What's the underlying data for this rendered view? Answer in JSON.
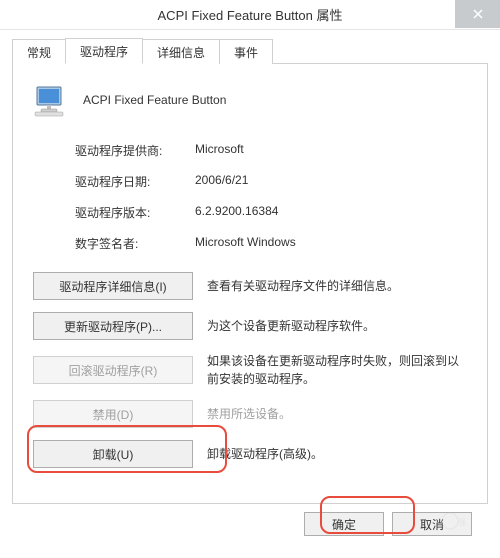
{
  "title": "ACPI Fixed Feature Button 属性",
  "tabs": {
    "general": "常规",
    "driver": "驱动程序",
    "details": "详细信息",
    "events": "事件"
  },
  "device": {
    "name": "ACPI Fixed Feature Button"
  },
  "info": {
    "provider_label": "驱动程序提供商:",
    "provider_value": "Microsoft",
    "date_label": "驱动程序日期:",
    "date_value": "2006/6/21",
    "version_label": "驱动程序版本:",
    "version_value": "6.2.9200.16384",
    "signer_label": "数字签名者:",
    "signer_value": "Microsoft Windows"
  },
  "actions": {
    "details_btn": "驱动程序详细信息(I)",
    "details_desc": "查看有关驱动程序文件的详细信息。",
    "update_btn": "更新驱动程序(P)...",
    "update_desc": "为这个设备更新驱动程序软件。",
    "rollback_btn": "回滚驱动程序(R)",
    "rollback_desc": "如果该设备在更新驱动程序时失败，则回滚到以前安装的驱动程序。",
    "disable_btn": "禁用(D)",
    "disable_desc": "禁用所选设备。",
    "uninstall_btn": "卸载(U)",
    "uninstall_desc": "卸载驱动程序(高级)。"
  },
  "buttons": {
    "ok": "确定",
    "cancel": "取消"
  }
}
